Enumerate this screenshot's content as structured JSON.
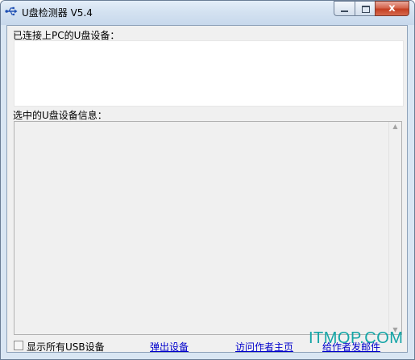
{
  "window": {
    "title": "U盘检测器 V5.4",
    "icon": "usb-icon",
    "close_glyph": "x"
  },
  "devices_panel": {
    "label": "已连接上PC的U盘设备："
  },
  "info_panel": {
    "label": "选中的U盘设备信息：",
    "scroll_up": "▲",
    "scroll_down": "▼"
  },
  "bottom_bar": {
    "show_all_label": "显示所有USB设备",
    "show_all_checked": false,
    "eject_label": "弹出设备",
    "homepage_label": "访问作者主页",
    "email_label": "给作者发邮件"
  },
  "watermark": {
    "text": "ITMOP.COM"
  },
  "colors": {
    "link": "#0000cc",
    "watermark": "#14a5a6",
    "close": "#c43f22"
  }
}
